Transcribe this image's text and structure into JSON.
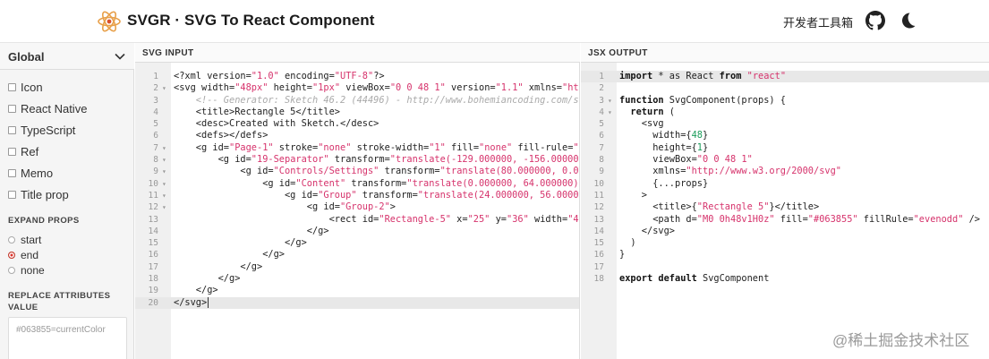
{
  "header": {
    "title": "SVGR · SVG To React Component",
    "tools_link": "开发者工具箱"
  },
  "sidebar": {
    "select_value": "Global",
    "options": [
      {
        "label": "Icon",
        "checked": false
      },
      {
        "label": "React Native",
        "checked": false
      },
      {
        "label": "TypeScript",
        "checked": false
      },
      {
        "label": "Ref",
        "checked": false
      },
      {
        "label": "Memo",
        "checked": false
      },
      {
        "label": "Title prop",
        "checked": false
      }
    ],
    "expand_props": {
      "heading": "EXPAND PROPS",
      "choices": [
        "start",
        "end",
        "none"
      ],
      "selected": "end"
    },
    "replace_attributes": {
      "heading_line1": "REPLACE ATTRIBUTES",
      "heading_line2": "VALUE",
      "placeholder": "#063855=currentColor"
    }
  },
  "svg_input": {
    "label": "SVG INPUT",
    "active_line": 20,
    "lines": [
      {
        "n": "1",
        "fold": "",
        "text": "<?xml version=\"1.0\" encoding=\"UTF-8\"?>"
      },
      {
        "n": "2",
        "fold": "▾",
        "text": "<svg width=\"48px\" height=\"1px\" viewBox=\"0 0 48 1\" version=\"1.1\" xmlns=\"ht"
      },
      {
        "n": "3",
        "fold": "",
        "text": "    <!-- Generator: Sketch 46.2 (44496) - http://www.bohemiancoding.com/s"
      },
      {
        "n": "4",
        "fold": "",
        "text": "    <title>Rectangle 5</title>"
      },
      {
        "n": "5",
        "fold": "",
        "text": "    <desc>Created with Sketch.</desc>"
      },
      {
        "n": "6",
        "fold": "",
        "text": "    <defs></defs>"
      },
      {
        "n": "7",
        "fold": "▾",
        "text": "    <g id=\"Page-1\" stroke=\"none\" stroke-width=\"1\" fill=\"none\" fill-rule=\""
      },
      {
        "n": "8",
        "fold": "▾",
        "text": "        <g id=\"19-Separator\" transform=\"translate(-129.000000, -156.00000"
      },
      {
        "n": "9",
        "fold": "▾",
        "text": "            <g id=\"Controls/Settings\" transform=\"translate(80.000000, 0.0"
      },
      {
        "n": "10",
        "fold": "▾",
        "text": "                <g id=\"Content\" transform=\"translate(0.000000, 64.000000)"
      },
      {
        "n": "11",
        "fold": "▾",
        "text": "                    <g id=\"Group\" transform=\"translate(24.000000, 56.0000"
      },
      {
        "n": "12",
        "fold": "▾",
        "text": "                        <g id=\"Group-2\">"
      },
      {
        "n": "13",
        "fold": "",
        "text": "                            <rect id=\"Rectangle-5\" x=\"25\" y=\"36\" width=\"4"
      },
      {
        "n": "14",
        "fold": "",
        "text": "                        </g>"
      },
      {
        "n": "15",
        "fold": "",
        "text": "                    </g>"
      },
      {
        "n": "16",
        "fold": "",
        "text": "                </g>"
      },
      {
        "n": "17",
        "fold": "",
        "text": "            </g>"
      },
      {
        "n": "18",
        "fold": "",
        "text": "        </g>"
      },
      {
        "n": "19",
        "fold": "",
        "text": "    </g>"
      },
      {
        "n": "20",
        "fold": "",
        "text": "</svg>"
      }
    ]
  },
  "jsx_output": {
    "label": "JSX OUTPUT",
    "active_line": 1,
    "lines": [
      {
        "n": "1",
        "fold": "",
        "text": "import * as React from \"react\""
      },
      {
        "n": "2",
        "fold": "",
        "text": ""
      },
      {
        "n": "3",
        "fold": "▾",
        "text": "function SvgComponent(props) {"
      },
      {
        "n": "4",
        "fold": "▾",
        "text": "  return ("
      },
      {
        "n": "5",
        "fold": "",
        "text": "    <svg"
      },
      {
        "n": "6",
        "fold": "",
        "text": "      width={48}"
      },
      {
        "n": "7",
        "fold": "",
        "text": "      height={1}"
      },
      {
        "n": "8",
        "fold": "",
        "text": "      viewBox=\"0 0 48 1\""
      },
      {
        "n": "9",
        "fold": "",
        "text": "      xmlns=\"http://www.w3.org/2000/svg\""
      },
      {
        "n": "10",
        "fold": "",
        "text": "      {...props}"
      },
      {
        "n": "11",
        "fold": "",
        "text": "    >"
      },
      {
        "n": "12",
        "fold": "",
        "text": "      <title>{\"Rectangle 5\"}</title>"
      },
      {
        "n": "13",
        "fold": "",
        "text": "      <path d=\"M0 0h48v1H0z\" fill=\"#063855\" fillRule=\"evenodd\" />"
      },
      {
        "n": "14",
        "fold": "",
        "text": "    </svg>"
      },
      {
        "n": "15",
        "fold": "",
        "text": "  )"
      },
      {
        "n": "16",
        "fold": "",
        "text": "}"
      },
      {
        "n": "17",
        "fold": "",
        "text": ""
      },
      {
        "n": "18",
        "fold": "",
        "text": "export default SvgComponent"
      }
    ]
  },
  "watermark": "@稀土掘金技术社区",
  "colors": {
    "string": "#d6336c",
    "number": "#1a9c5a",
    "comment": "#aaaaaa",
    "radio_selected": "#e0332d"
  }
}
